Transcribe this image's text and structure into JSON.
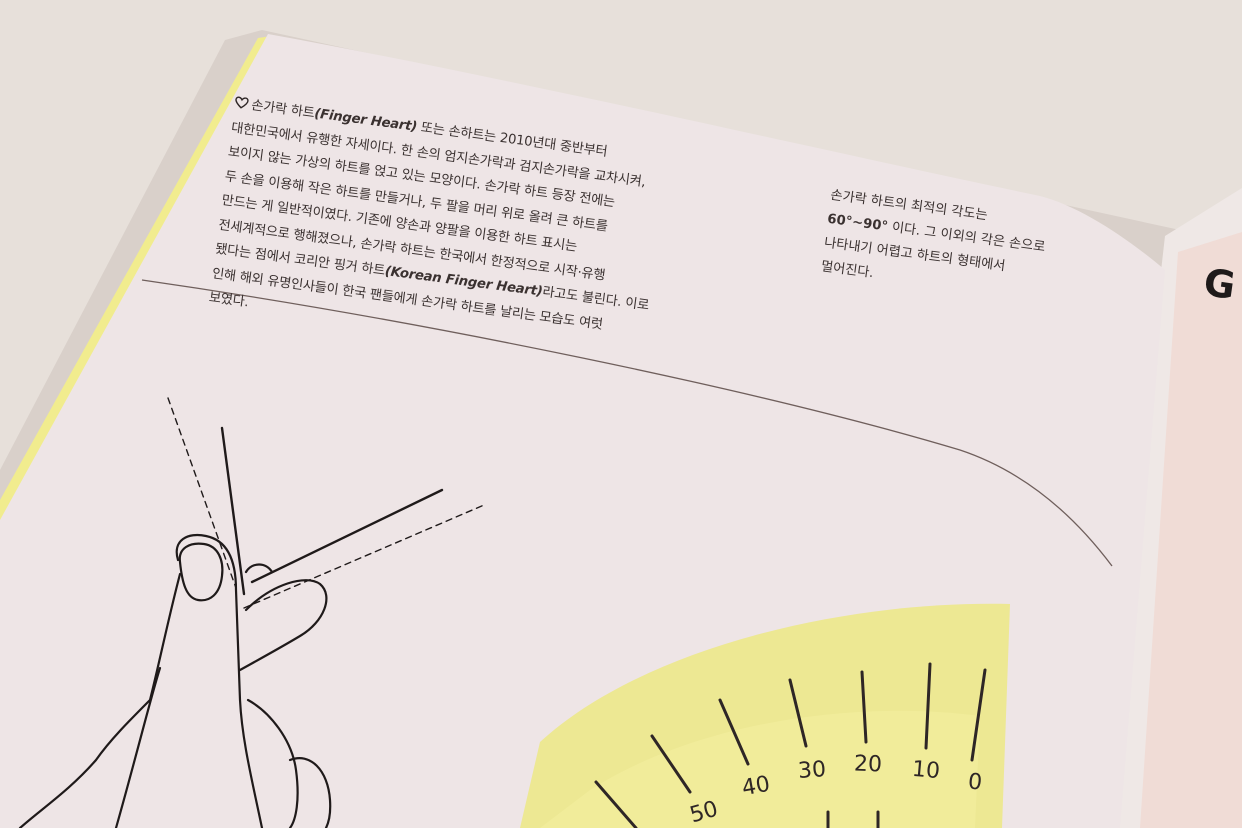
{
  "main_text": {
    "line1_a": "손가락 하트",
    "line1_b": "(Finger Heart)",
    "line1_c": " 또는 손하트는 2010년대 중반부터",
    "line2": "대한민국에서 유행한 자세이다. 한 손의 엄지손가락과 검지손가락을 교차시켜,",
    "line3": "보이지 않는 가상의 하트를 얹고 있는 모양이다. 손가락 하트 등장 전에는",
    "line4": "두 손을 이용해 작은 하트를 만들거나, 두 팔을 머리 위로 올려 큰 하트를",
    "line5": "만드는 게 일반적이였다. 기존에 양손과 양팔을 이용한 하트 표시는",
    "line6": "전세계적으로 행해졌으나, 손가락 하트는 한국에서 한정적으로 시작·유행",
    "line7_a": "됐다는 점에서 코리안 핑거 하트",
    "line7_b": "(Korean Finger Heart)",
    "line7_c": "라고도 불린다. 이로",
    "line8": "인해 해외 유명인사들이 한국 팬들에게 손가락 하트를 날리는 모습도 여럿",
    "line9": "보였다."
  },
  "side_text": {
    "line1": "손가락 하트의 최적의 각도는",
    "line2_a": "60°~90°",
    "line2_b": " 이다. 그 이외의 각은 손으로",
    "line3": "나타내기 어렵고 하트의 형태에서",
    "line4": "멀어진다."
  },
  "protractor": {
    "labels": [
      "0",
      "10",
      "20",
      "30",
      "40",
      "50"
    ]
  },
  "right_page": {
    "partial_title": "G"
  },
  "colors": {
    "page": "#efe6e8",
    "yellow": "#ece889",
    "ink": "#2e2626",
    "rule": "#6f5f5c",
    "table": "#e6ded8"
  }
}
